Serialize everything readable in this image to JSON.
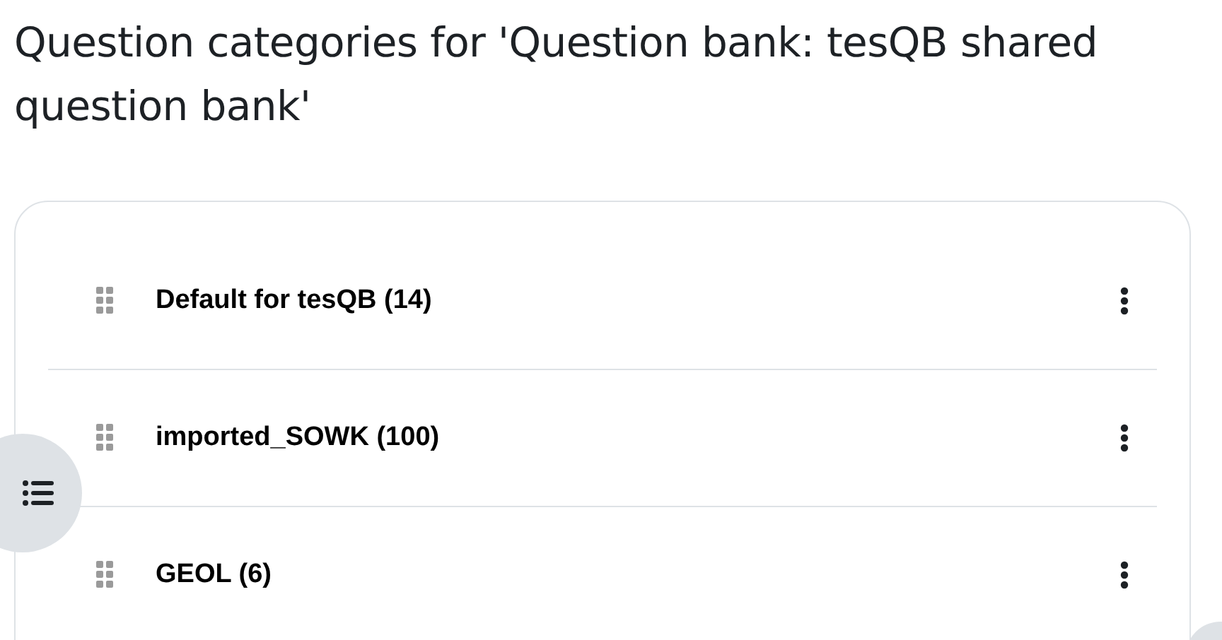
{
  "title": "Question categories for 'Question bank: tesQB shared question bank'",
  "categories": [
    {
      "name": "Default for tesQB (14)"
    },
    {
      "name": "imported_SOWK (100)"
    },
    {
      "name": "GEOL (6)"
    }
  ]
}
